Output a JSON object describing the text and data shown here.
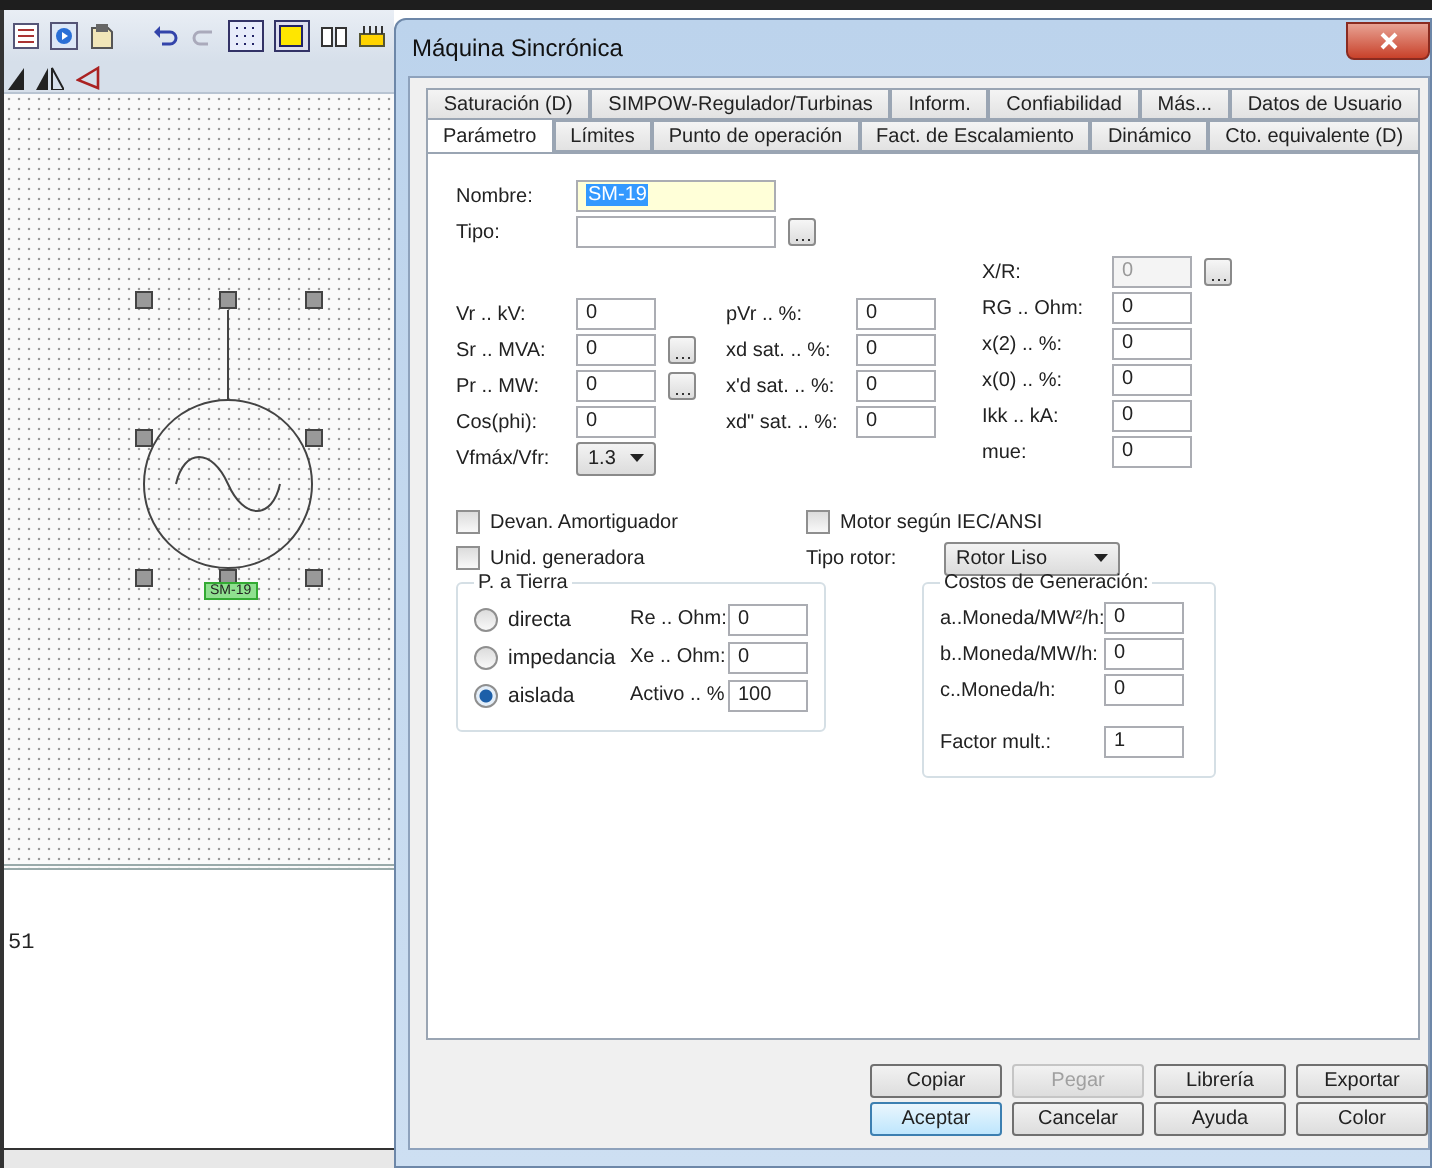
{
  "canvas": {
    "element_label": "SM-19"
  },
  "output": {
    "text": "51"
  },
  "dialog": {
    "title": "Máquina Sincrónica",
    "tabs_row_1": [
      {
        "label": "Saturación (D)",
        "selected": false
      },
      {
        "label": "SIMPOW-Regulador/Turbinas",
        "selected": false
      },
      {
        "label": "Inform.",
        "selected": false
      },
      {
        "label": "Confiabilidad",
        "selected": false
      },
      {
        "label": "Más...",
        "selected": false
      },
      {
        "label": "Datos de Usuario",
        "selected": false
      }
    ],
    "tabs_row_2": [
      {
        "label": "Parámetro",
        "selected": true
      },
      {
        "label": "Límites",
        "selected": false
      },
      {
        "label": "Punto de operación",
        "selected": false
      },
      {
        "label": "Fact. de Escalamiento",
        "selected": false
      },
      {
        "label": "Dinámico",
        "selected": false
      },
      {
        "label": "Cto. equivalente (D)",
        "selected": false
      }
    ],
    "name": {
      "label": "Nombre:",
      "value": "SM-19"
    },
    "type": {
      "label": "Tipo:"
    },
    "columns": [
      [
        {
          "kind": "input",
          "label": "Vr .. kV:",
          "value": "0",
          "browse": false,
          "disabled": false
        },
        {
          "kind": "input",
          "label": "Sr .. MVA:",
          "value": "0",
          "browse": true,
          "disabled": false
        },
        {
          "kind": "input",
          "label": "Pr .. MW:",
          "value": "0",
          "browse": true,
          "disabled": false
        },
        {
          "kind": "input",
          "label": "Cos(phi):",
          "value": "0",
          "browse": false,
          "disabled": false
        },
        {
          "kind": "select",
          "label": "Vfmáx/Vfr:",
          "value": "1.3",
          "browse": false,
          "disabled": false
        }
      ],
      [
        {
          "kind": "input",
          "label": "pVr .. %:",
          "value": "0",
          "browse": false,
          "disabled": false
        },
        {
          "kind": "input",
          "label": "xd sat. .. %:",
          "value": "0",
          "browse": false,
          "disabled": false
        },
        {
          "kind": "input",
          "label": "x'd sat. .. %:",
          "value": "0",
          "browse": false,
          "disabled": false
        },
        {
          "kind": "input",
          "label": "xd\" sat. .. %:",
          "value": "0",
          "browse": false,
          "disabled": false
        }
      ],
      [
        {
          "kind": "input",
          "label": "X/R:",
          "value": "0",
          "browse": true,
          "disabled": true
        },
        {
          "kind": "input",
          "label": "RG .. Ohm:",
          "value": "0",
          "browse": false,
          "disabled": false
        },
        {
          "kind": "input",
          "label": "x(2) .. %:",
          "value": "0",
          "browse": false,
          "disabled": false
        },
        {
          "kind": "input",
          "label": "x(0) .. %:",
          "value": "0",
          "browse": false,
          "disabled": false
        },
        {
          "kind": "input",
          "label": "Ikk .. kA:",
          "value": "0",
          "browse": false,
          "disabled": false
        },
        {
          "kind": "input",
          "label": "mue:",
          "value": "0",
          "browse": false,
          "disabled": false
        }
      ]
    ],
    "checkboxes": [
      {
        "label": "Devan. Amortiguador",
        "checked": false
      },
      {
        "label": "Motor según IEC/ANSI",
        "checked": false
      },
      {
        "label": "Unid. generadora",
        "checked": false
      }
    ],
    "rotor_type": {
      "label": "Tipo rotor:",
      "value": "Rotor Liso"
    },
    "grounding": {
      "title": "P. a Tierra",
      "options": [
        {
          "label": "directa",
          "selected": false
        },
        {
          "label": "impedancia",
          "selected": false
        },
        {
          "label": "aislada",
          "selected": true
        }
      ],
      "fields": [
        {
          "label": "Re .. Ohm:",
          "value": "0"
        },
        {
          "label": "Xe .. Ohm:",
          "value": "0"
        },
        {
          "label": "Activo .. %",
          "value": "100"
        }
      ]
    },
    "costs": {
      "title": "Costos de Generación:",
      "fields": [
        {
          "label": "a..Moneda/MW²/h:",
          "value": "0"
        },
        {
          "label": "b..Moneda/MW/h:",
          "value": "0"
        },
        {
          "label": "c..Moneda/h:",
          "value": "0"
        }
      ],
      "factor": {
        "label": "Factor mult.:",
        "value": "1"
      }
    },
    "buttons": [
      [
        {
          "label": "Copiar",
          "disabled": false,
          "default": false
        },
        {
          "label": "Pegar",
          "disabled": true,
          "default": false
        },
        {
          "label": "Librería",
          "disabled": false,
          "default": false
        },
        {
          "label": "Exportar",
          "disabled": false,
          "default": false
        }
      ],
      [
        {
          "label": "Aceptar",
          "disabled": false,
          "default": true
        },
        {
          "label": "Cancelar",
          "disabled": false,
          "default": false
        },
        {
          "label": "Ayuda",
          "disabled": false,
          "default": false
        },
        {
          "label": "Color",
          "disabled": false,
          "default": false
        }
      ]
    ]
  }
}
